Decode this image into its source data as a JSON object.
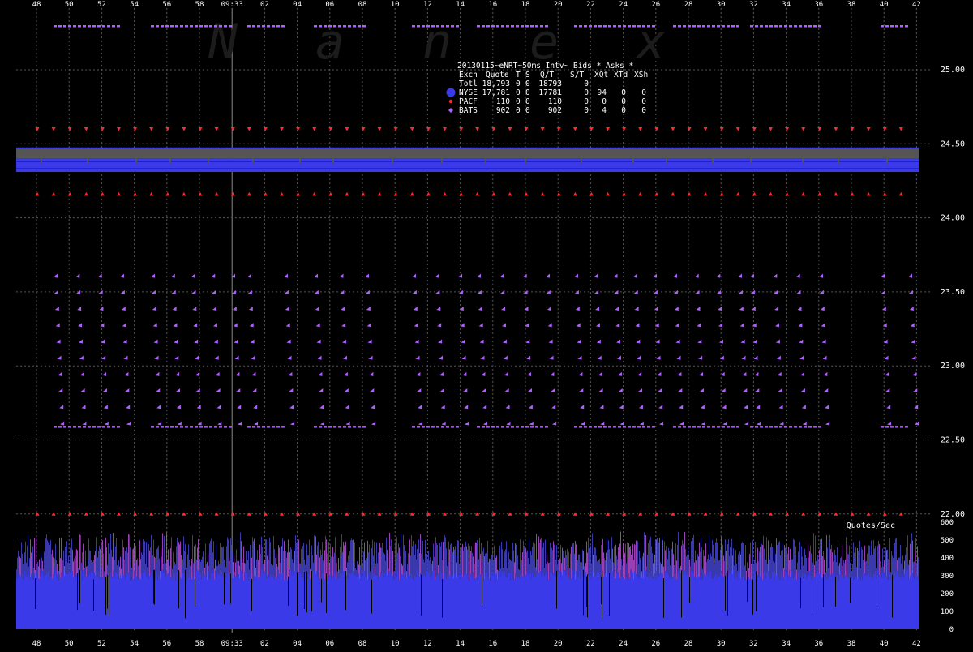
{
  "chart_data": {
    "type": "scatter",
    "title": "20130115~eNRT~50ms Intv~ Bids * Asks *",
    "watermark": "Nanex",
    "x_tick_labels": [
      "48",
      "50",
      "52",
      "54",
      "56",
      "58",
      "09:33",
      "02",
      "04",
      "06",
      "08",
      "10",
      "12",
      "14",
      "16",
      "18",
      "20",
      "22",
      "24",
      "26",
      "28",
      "30",
      "32",
      "34",
      "36",
      "38",
      "40",
      "42"
    ],
    "price_axis": {
      "ylim": [
        21.98,
        25.13
      ],
      "tick_labels": [
        "25.00",
        "24.50",
        "24.00",
        "23.50",
        "23.00",
        "22.50",
        "22.00"
      ]
    },
    "rate_axis": {
      "label": "Quotes/Sec",
      "ylim": [
        0,
        600
      ],
      "tick_labels": [
        "600",
        "500",
        "400",
        "300",
        "200",
        "100",
        "0"
      ]
    },
    "legend": {
      "header": [
        "Exch",
        "Quote",
        "T",
        "S",
        "Q/T",
        "S/T",
        "XQt",
        "XTd",
        "XSh"
      ],
      "rows": [
        {
          "exch": "Totl",
          "quote": "18,793",
          "t": "0",
          "s": "0",
          "qt": "18793",
          "st": "0",
          "xqt": "",
          "xtd": "",
          "xsh": "",
          "marker": "none",
          "color": ""
        },
        {
          "exch": "NYSE",
          "quote": "17,781",
          "t": "0",
          "s": "0",
          "qt": "17781",
          "st": "0",
          "xqt": "94",
          "xtd": "0",
          "xsh": "0",
          "marker": "hexagon",
          "color": "#3a3ae8"
        },
        {
          "exch": "PACF",
          "quote": "110",
          "t": "0",
          "s": "0",
          "qt": "110",
          "st": "0",
          "xqt": "0",
          "xtd": "0",
          "xsh": "0",
          "marker": "dot",
          "color": "#ff2a2a"
        },
        {
          "exch": "BATS",
          "quote": "902",
          "t": "0",
          "s": "0",
          "qt": "902",
          "st": "0",
          "xqt": "4",
          "xtd": "0",
          "xsh": "0",
          "marker": "diamond",
          "color": "#b060ff"
        }
      ]
    },
    "series": [
      {
        "name": "NYSE",
        "kind": "bid/ask band",
        "ask": 24.47,
        "bid": 24.31,
        "color": "#3a3ae8"
      },
      {
        "name": "PACF",
        "kind": "bid/ask quotes",
        "ask": 24.6,
        "bid": 24.16,
        "low_bid": 22.0,
        "color": "#ff2a2a"
      },
      {
        "name": "BATS",
        "kind": "bid/ask quotes",
        "ask": 25.22,
        "bid": 22.59,
        "ladder_top": 23.6,
        "color": "#b060ff"
      }
    ],
    "rate_series": {
      "name": "Quotes/Sec",
      "baseline": 300,
      "color": "#3a3ae8"
    },
    "cursor_label": "09:33",
    "colors": {
      "background": "#000000",
      "grid": "#555555",
      "text": "#ffffff",
      "band_gray": "#555555"
    }
  }
}
